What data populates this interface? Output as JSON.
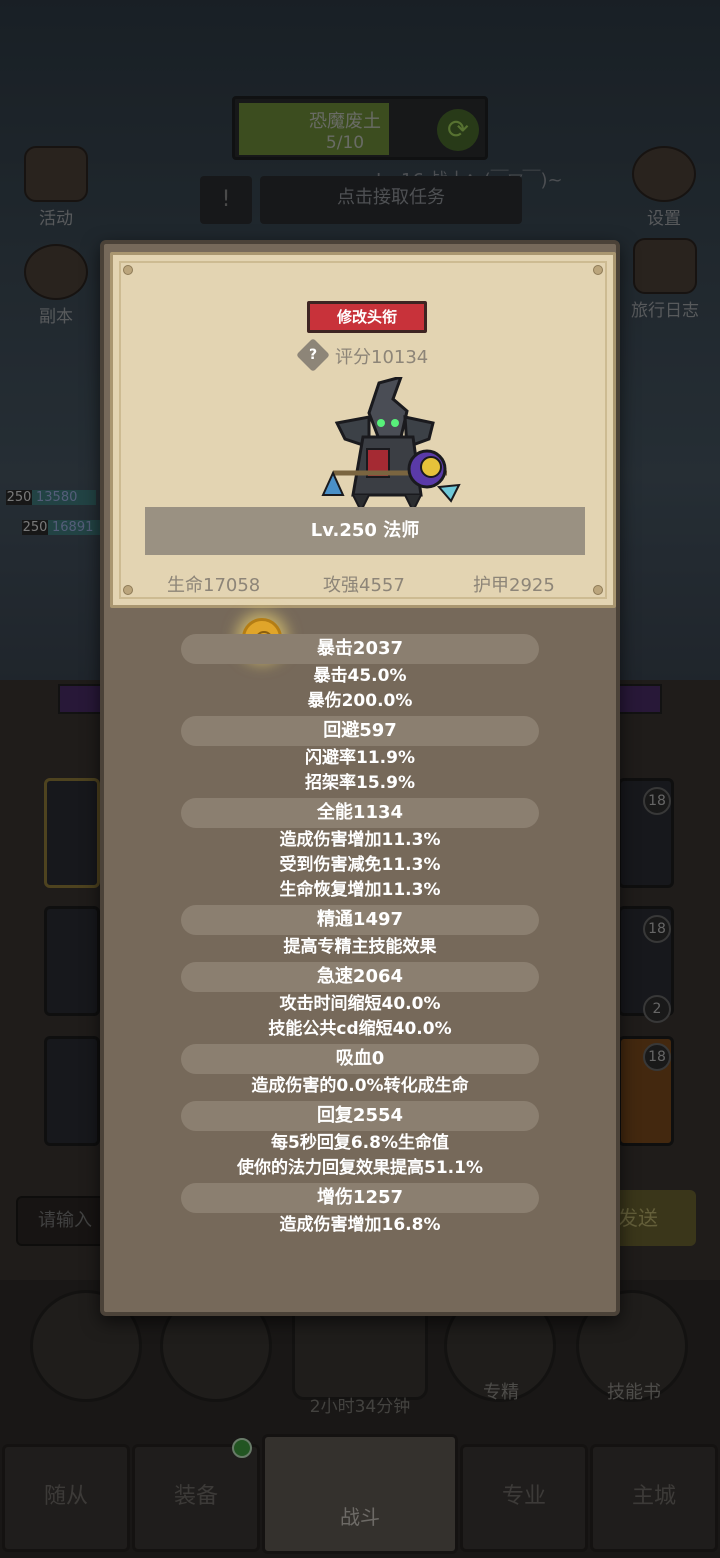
{
  "background": {
    "quest": {
      "title": "恐魔废土",
      "progress": "5/10"
    },
    "player_line": "Lv.16 战士：(￣▽￣)~",
    "task_button": "点击接取任务",
    "left_icons": [
      {
        "label": "活动"
      },
      {
        "label": "副本"
      }
    ],
    "right_icons": [
      {
        "label": "设置"
      },
      {
        "label": "旅行日志"
      }
    ],
    "units": [
      {
        "level": "250",
        "hp": "13580"
      },
      {
        "level": "250",
        "hp": "16891"
      }
    ],
    "item_badges": [
      "18",
      "18",
      "2",
      "18"
    ],
    "chat_placeholder": "请输入",
    "send_label": "发送",
    "bottom_labels": {
      "specialization": "专精",
      "skill_book": "技能书"
    },
    "timer": "2小时34分钟",
    "nav": [
      {
        "label": "随从"
      },
      {
        "label": "装备"
      },
      {
        "label": "战斗"
      },
      {
        "label": "专业"
      },
      {
        "label": "主城"
      }
    ]
  },
  "panel": {
    "edit_title_button": "修改头衔",
    "help_glyph": "?",
    "score": "评分10134",
    "level_class": "Lv.250 法师",
    "basic_stats": {
      "hp": "生命17058",
      "attack": "攻强4557",
      "armor": "护甲2925"
    },
    "stat_groups": [
      {
        "title": "暴击2037",
        "lines": [
          "暴击45.0%",
          "暴伤200.0%"
        ]
      },
      {
        "title": "回避597",
        "lines": [
          "闪避率11.9%",
          "招架率15.9%"
        ]
      },
      {
        "title": "全能1134",
        "lines": [
          "造成伤害增加11.3%",
          "受到伤害减免11.3%",
          "生命恢复增加11.3%"
        ]
      },
      {
        "title": "精通1497",
        "lines": [
          "提高专精主技能效果"
        ]
      },
      {
        "title": "急速2064",
        "lines": [
          "攻击时间缩短40.0%",
          "技能公共cd缩短40.0%"
        ]
      },
      {
        "title": "吸血0",
        "lines": [
          "造成伤害的0.0%转化成生命"
        ]
      },
      {
        "title": "回复2554",
        "lines": [
          "每5秒回复6.8%生命值",
          "使你的法力回复效果提高51.1%"
        ]
      },
      {
        "title": "增伤1257",
        "lines": [
          "造成伤害增加16.8%"
        ]
      }
    ]
  },
  "colors": {
    "edit_button": "#c8323a",
    "parchment": "#e3d4b2",
    "panel_body": "#76695a"
  }
}
